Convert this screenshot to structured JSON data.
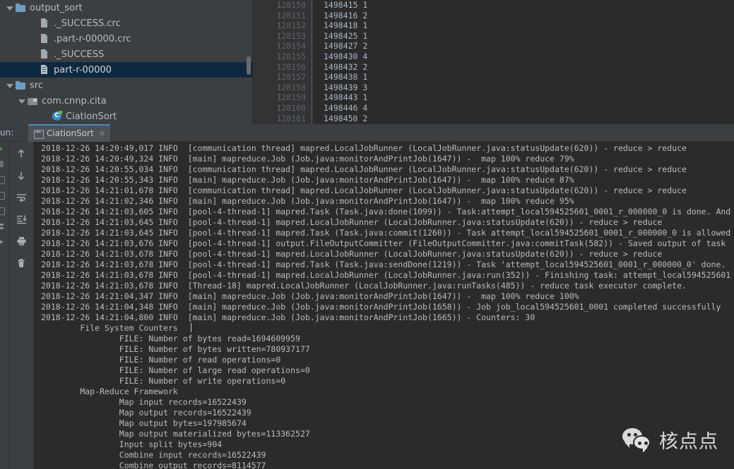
{
  "project_tree": {
    "rows": [
      {
        "label": "output_sort",
        "indent": 0,
        "icon": "folder-icon",
        "twisty": "open",
        "selected": false
      },
      {
        "label": "._SUCCESS.crc",
        "indent": 2,
        "icon": "file-query-icon",
        "twisty": "none",
        "selected": false
      },
      {
        "label": ".part-r-00000.crc",
        "indent": 2,
        "icon": "file-query-icon",
        "twisty": "none",
        "selected": false
      },
      {
        "label": "._SUCCESS",
        "indent": 2,
        "icon": "file-query-icon",
        "twisty": "none",
        "selected": false
      },
      {
        "label": "part-r-00000",
        "indent": 2,
        "icon": "text-file-icon",
        "twisty": "none",
        "selected": true
      },
      {
        "label": "src",
        "indent": 0,
        "icon": "folder-icon",
        "twisty": "open",
        "selected": false
      },
      {
        "label": "com.cnnp.cita",
        "indent": 1,
        "icon": "package-icon",
        "twisty": "open",
        "selected": false
      },
      {
        "label": "CiationSort",
        "indent": 3,
        "icon": "java-class-icon",
        "twisty": "none",
        "selected": false
      }
    ]
  },
  "editor": {
    "lines": [
      {
        "number": "128150",
        "text": "1498415 1"
      },
      {
        "number": "128151",
        "text": "1498416 2"
      },
      {
        "number": "128152",
        "text": "1498418 1"
      },
      {
        "number": "128153",
        "text": "1498425 1"
      },
      {
        "number": "128154",
        "text": "1498427 2"
      },
      {
        "number": "128155",
        "text": "1498430 4"
      },
      {
        "number": "128156",
        "text": "1498432 2"
      },
      {
        "number": "128157",
        "text": "1498438 1"
      },
      {
        "number": "128158",
        "text": "1498439 3"
      },
      {
        "number": "128159",
        "text": "1498443 1"
      },
      {
        "number": "128160",
        "text": "1498446 4"
      },
      {
        "number": "128161",
        "text": "1498450 2"
      }
    ]
  },
  "run_panel": {
    "window_label": "un:",
    "tab": {
      "label": "CiationSort",
      "close": "×",
      "icon": "run-configuration-icon"
    },
    "runner_gutter_icons": [
      "rerun-icon",
      "stop-icon",
      "stop-icon-2",
      "resume-icon",
      "layout-icon",
      "expand-icon"
    ],
    "toolbar_buttons": [
      {
        "name": "up-arrow-icon",
        "title": "Up"
      },
      {
        "name": "down-arrow-icon",
        "title": "Down"
      },
      {
        "name": "soft-wrap-icon",
        "title": "Soft-Wrap"
      },
      {
        "name": "scroll-to-end-icon",
        "title": "Scroll to end"
      },
      {
        "name": "print-icon",
        "title": "Print"
      },
      {
        "name": "trash-icon",
        "title": "Clear All"
      }
    ],
    "console_lines": [
      "2018-12-26 14:20:49,017 INFO  [communication thread] mapred.LocalJobRunner (LocalJobRunner.java:statusUpdate(620)) - reduce > reduce",
      "2018-12-26 14:20:49,324 INFO  [main] mapreduce.Job (Job.java:monitorAndPrintJob(1647)) -  map 100% reduce 79%",
      "2018-12-26 14:20:55,034 INFO  [communication thread] mapred.LocalJobRunner (LocalJobRunner.java:statusUpdate(620)) - reduce > reduce",
      "2018-12-26 14:20:55,343 INFO  [main] mapreduce.Job (Job.java:monitorAndPrintJob(1647)) -  map 100% reduce 87%",
      "2018-12-26 14:21:01,678 INFO  [communication thread] mapred.LocalJobRunner (LocalJobRunner.java:statusUpdate(620)) - reduce > reduce",
      "2018-12-26 14:21:02,346 INFO  [main] mapreduce.Job (Job.java:monitorAndPrintJob(1647)) -  map 100% reduce 95%",
      "2018-12-26 14:21:03,605 INFO  [pool-4-thread-1] mapred.Task (Task.java:done(1099)) - Task:attempt_local594525601_0001_r_000000_0 is done. And",
      "2018-12-26 14:21:03,645 INFO  [pool-4-thread-1] mapred.LocalJobRunner (LocalJobRunner.java:statusUpdate(620)) - reduce > reduce",
      "2018-12-26 14:21:03,645 INFO  [pool-4-thread-1] mapred.Task (Task.java:commit(1260)) - Task attempt_local594525601_0001_r_000000_0 is allowed",
      "2018-12-26 14:21:03,676 INFO  [pool-4-thread-1] output.FileOutputCommitter (FileOutputCommitter.java:commitTask(582)) - Saved output of task",
      "2018-12-26 14:21:03,678 INFO  [pool-4-thread-1] mapred.LocalJobRunner (LocalJobRunner.java:statusUpdate(620)) - reduce > reduce",
      "2018-12-26 14:21:03,678 INFO  [pool-4-thread-1] mapred.Task (Task.java:sendDone(1219)) - Task 'attempt_local594525601_0001_r_000000_0' done.",
      "2018-12-26 14:21:03,678 INFO  [pool-4-thread-1] mapred.LocalJobRunner (LocalJobRunner.java:run(352)) - Finishing task: attempt_local594525601",
      "2018-12-26 14:21:03,678 INFO  [Thread-18] mapred.LocalJobRunner (LocalJobRunner.java:runTasks(485)) - reduce task executor complete.",
      "2018-12-26 14:21:04,347 INFO  [main] mapreduce.Job (Job.java:monitorAndPrintJob(1647)) -  map 100% reduce 100%",
      "2018-12-26 14:21:04,348 INFO  [main] mapreduce.Job (Job.java:monitorAndPrintJob(1658)) - Job job_local594525601_0001 completed successfully",
      "2018-12-26 14:21:04,800 INFO  [main] mapreduce.Job (Job.java:monitorAndPrintJob(1665)) - Counters: 30",
      "        File System Counters",
      "                FILE: Number of bytes read=1694609959",
      "                FILE: Number of bytes written=780937177",
      "                FILE: Number of read operations=0",
      "                FILE: Number of large read operations=0",
      "                FILE: Number of write operations=0",
      "        Map-Reduce Framework",
      "                Map input records=16522439",
      "                Map output records=16522439",
      "                Map output bytes=197985674",
      "                Map output materialized bytes=113362527",
      "                Input split bytes=904",
      "                Combine input records=16522439",
      "                Combine output records=8114577"
    ]
  },
  "watermark": {
    "text": "核点点",
    "icon": "wechat-icon"
  },
  "colors": {
    "panel_bg": "#3c3f41",
    "editor_bg": "#2b2b2b",
    "selection_blue": "#0d293f",
    "tab_accent": "#4a88c7",
    "text_primary": "#bbbbbb",
    "gutter_text": "#606366",
    "folder_blue": "#6e9ec4",
    "run_green": "#4f9d43"
  }
}
